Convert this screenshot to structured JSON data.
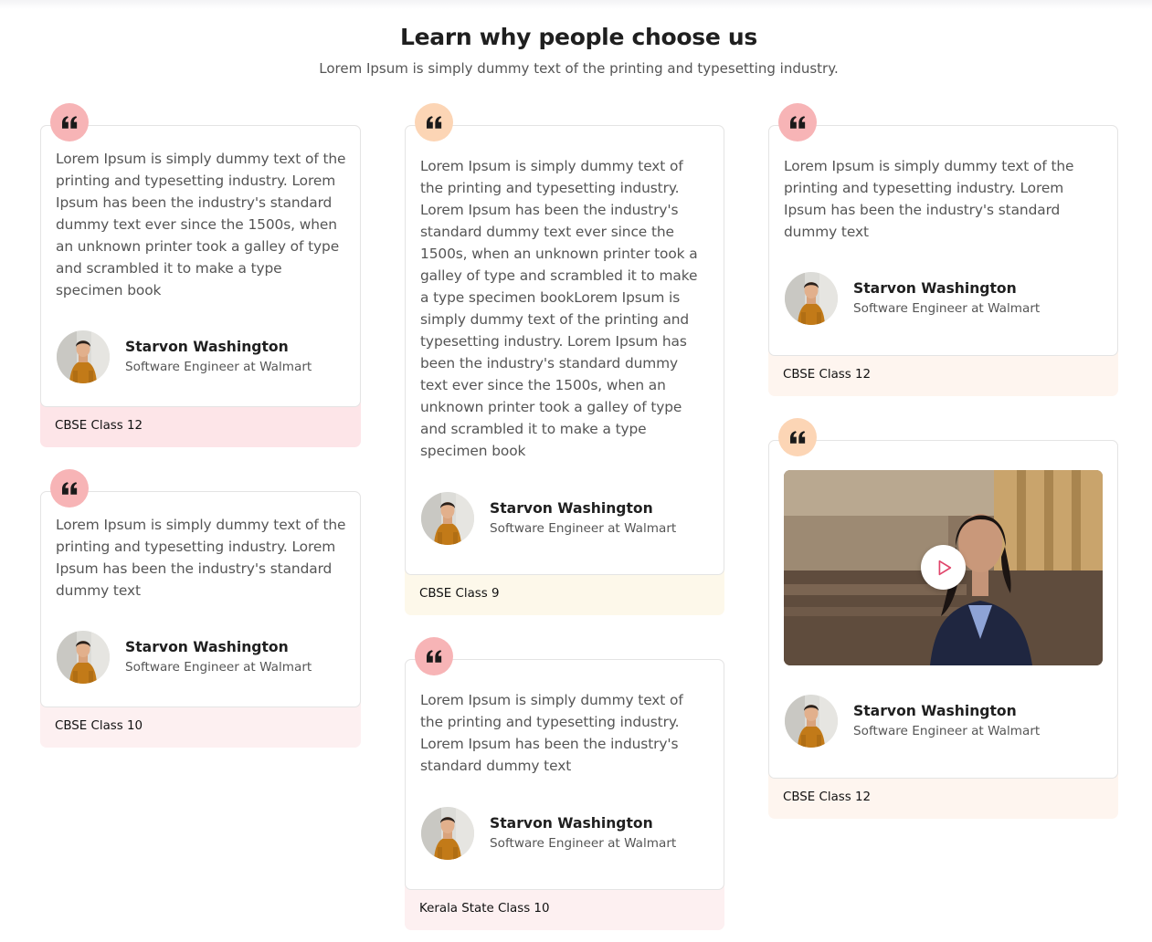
{
  "header": {
    "title": "Learn why people choose us",
    "subtitle": "Lorem Ipsum is simply dummy text of the printing and typesetting industry."
  },
  "colors": {
    "badge_pink": "#f7b4b6",
    "badge_peach": "#fcd5b5",
    "footer_pink": "#fde5e8",
    "footer_light_pink": "#fdf0f1",
    "footer_cream": "#fdf8ea",
    "footer_peach": "#fef5ef",
    "play_accent": "#e0456b"
  },
  "icons": {
    "quote": "quote-icon",
    "play": "play-icon",
    "avatar": "avatar-photo"
  },
  "testimonials": [
    {
      "text": "Lorem Ipsum is simply dummy text of the printing and typesetting industry. Lorem Ipsum has been the industry's standard dummy text ever since the 1500s, when an unknown printer took a galley of type and scrambled it to make a type specimen book",
      "name": "Starvon Washington",
      "role": "Software Engineer at Walmart",
      "tag": "CBSE Class 12"
    },
    {
      "text": "Lorem Ipsum is simply dummy text of the printing and typesetting industry. Lorem Ipsum has been the industry's standard dummy text",
      "name": "Starvon Washington",
      "role": "Software Engineer at Walmart",
      "tag": "CBSE Class 10"
    },
    {
      "text": "Lorem Ipsum is simply dummy text of the printing and typesetting industry. Lorem Ipsum has been the industry's standard dummy text ever since the 1500s, when an unknown printer took a galley of type and scrambled it to make a type specimen bookLorem Ipsum is simply dummy text of the printing and typesetting industry. Lorem Ipsum has been the industry's standard dummy text ever since the 1500s, when an unknown printer took a galley of type and scrambled it to make a type specimen book",
      "name": "Starvon Washington",
      "role": "Software Engineer at Walmart",
      "tag": "CBSE Class 9"
    },
    {
      "text": "Lorem Ipsum is simply dummy text of the printing and typesetting industry. Lorem Ipsum has been the industry's standard dummy text",
      "name": "Starvon Washington",
      "role": "Software Engineer at Walmart",
      "tag": "Kerala State Class 10"
    },
    {
      "text": "Lorem Ipsum is simply dummy text of the printing and typesetting industry. Lorem Ipsum has been the industry's standard dummy text",
      "name": "Starvon Washington",
      "role": "Software Engineer at Walmart",
      "tag": "CBSE Class 12"
    },
    {
      "name": "Starvon Washington",
      "role": "Software Engineer at Walmart",
      "tag": "CBSE Class 12"
    }
  ]
}
